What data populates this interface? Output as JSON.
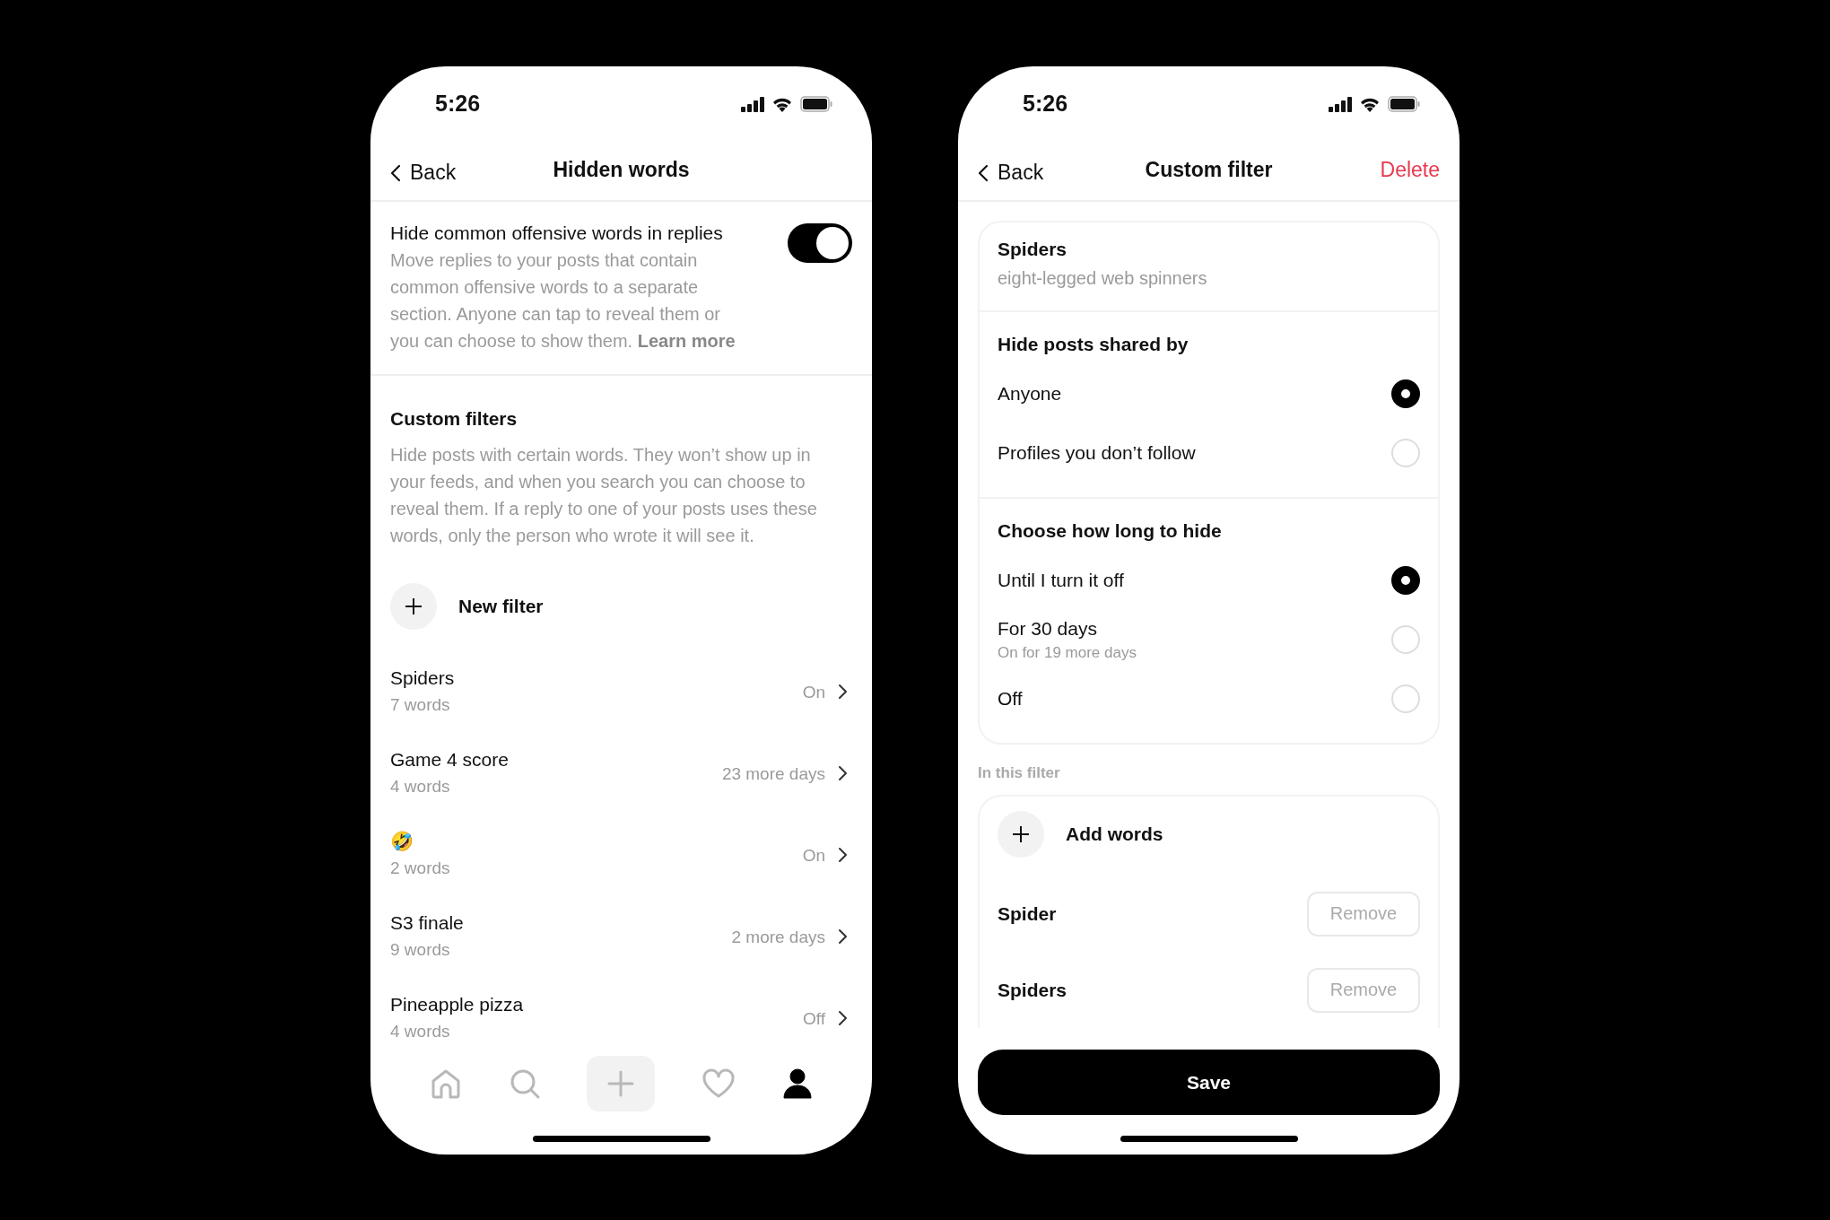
{
  "hidden_words_screen": {
    "status_bar": {
      "time": "5:26"
    },
    "nav": {
      "back": "Back",
      "title": "Hidden words"
    },
    "offensive_words": {
      "title": "Hide common offensive words in replies",
      "description": "Move replies to your posts that contain common offensive words to a separate section. Anyone can tap to reveal them or you can choose to show them.",
      "link": "Learn more",
      "on": true
    },
    "custom_filters": {
      "title": "Custom filters",
      "description": "Hide posts with certain words. They won’t show up in your feeds, and when you search you can choose to reveal them. If a reply to one of your posts uses these words, only the person who wrote it will see it.",
      "new_filter": "New filter",
      "filters": [
        {
          "name": "Spiders",
          "count": "7 words",
          "status": "On"
        },
        {
          "name": "Game 4 score",
          "count": "4 words",
          "status": "23 more days"
        },
        {
          "name": "🤣",
          "count": "2 words",
          "status": "On"
        },
        {
          "name": "S3 finale",
          "count": "9 words",
          "status": "2 more days"
        },
        {
          "name": "Pineapple pizza",
          "count": "4 words",
          "status": "Off"
        }
      ]
    },
    "tab_bar": [
      {
        "kind": "home",
        "selected": false
      },
      {
        "kind": "search",
        "selected": false
      },
      {
        "kind": "create",
        "selected": false
      },
      {
        "kind": "activity",
        "selected": false
      },
      {
        "kind": "profile",
        "selected": true
      }
    ]
  },
  "custom_filter_screen": {
    "status_bar": {
      "time": "5:26"
    },
    "nav": {
      "back": "Back",
      "title": "Custom filter",
      "action": "Delete"
    },
    "filter": {
      "name": "Spiders",
      "description": "eight-legged web spinners"
    },
    "shared_by": {
      "title": "Hide posts shared by",
      "options": [
        {
          "label": "Anyone",
          "selected": true
        },
        {
          "label": "Profiles you don’t follow",
          "selected": false
        }
      ]
    },
    "duration": {
      "title": "Choose how long to hide",
      "options": [
        {
          "label": "Until I turn it off",
          "selected": true
        },
        {
          "label": "For 30 days",
          "sublabel": "On for 19 more days",
          "selected": false
        },
        {
          "label": "Off",
          "selected": false
        }
      ]
    },
    "words_section": {
      "label": "In this filter",
      "add": "Add words",
      "words": [
        {
          "word": "Spider",
          "action": "Remove"
        },
        {
          "word": "Spiders",
          "action": "Remove"
        }
      ]
    },
    "save": "Save"
  }
}
